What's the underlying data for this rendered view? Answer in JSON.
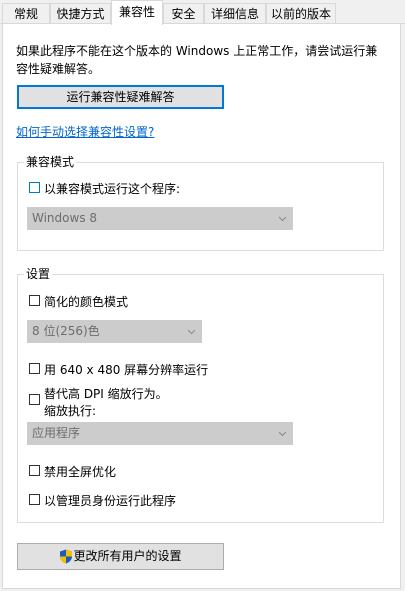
{
  "tabs": [
    {
      "label": "常规",
      "active": false
    },
    {
      "label": "快捷方式",
      "active": false
    },
    {
      "label": "兼容性",
      "active": true
    },
    {
      "label": "安全",
      "active": false
    },
    {
      "label": "详细信息",
      "active": false
    },
    {
      "label": "以前的版本",
      "active": false
    }
  ],
  "intro": {
    "line1": "如果此程序不能在这个版本的 Windows 上正常工作，请尝试运行兼",
    "line2": "容性疑难解答。"
  },
  "troubleshooter_button": "运行兼容性疑难解答",
  "manual_link": "如何手动选择兼容性设置?",
  "compat_mode": {
    "title": "兼容模式",
    "checkbox_label": "以兼容模式运行这个程序:",
    "checked": false,
    "os_select": "Windows 8"
  },
  "settings": {
    "title": "设置",
    "reduced_color": {
      "label": "简化的颜色模式",
      "checked": false
    },
    "color_select": "8 位(256)色",
    "res_640": {
      "label": "用 640 x 480 屏幕分辨率运行",
      "checked": false
    },
    "dpi_override": {
      "label_line1": "替代高 DPI 缩放行为。",
      "label_line2": "缩放执行:",
      "checked": false
    },
    "dpi_select": "应用程序",
    "disable_fullscreen": {
      "label": "禁用全屏优化",
      "checked": false
    },
    "run_as_admin": {
      "label": "以管理员身份运行此程序",
      "checked": false
    }
  },
  "all_users_button": "更改所有用户的设置",
  "colors": {
    "accent": "#0078d7",
    "link": "#0066cc",
    "disabled_select": "#cccccc",
    "shield_blue": "#1e5bb8",
    "shield_yellow": "#f2c200"
  }
}
